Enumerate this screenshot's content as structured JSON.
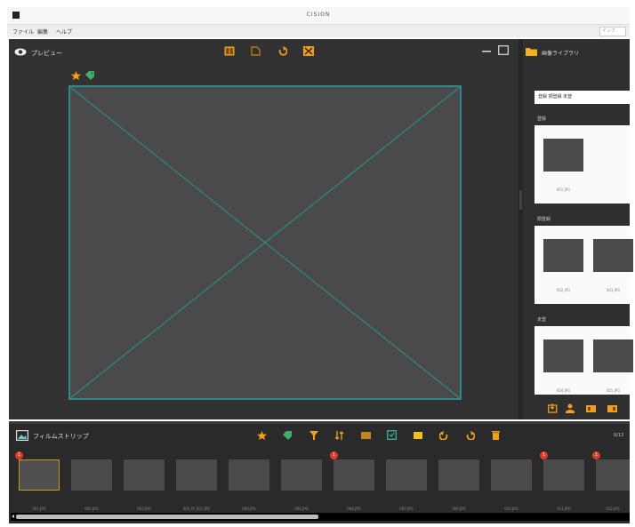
{
  "window": {
    "title": "CISION"
  },
  "menu": {
    "items": [
      "ファイル",
      "編集",
      "ヘルプ"
    ],
    "search_hint": "インフ"
  },
  "preview": {
    "label": "プレビュー",
    "colors": {
      "accent": "#f0a01a",
      "canvas_border": "#2e8a89",
      "panel": "#323232"
    }
  },
  "library": {
    "label": "画像ライブラリ",
    "select_value": "登録 顔登録 未登",
    "sections": [
      {
        "label": "登録",
        "items": [
          "001.JPG"
        ]
      },
      {
        "label": "顔登録",
        "items": [
          "002.JPG",
          "003.JPG"
        ]
      },
      {
        "label": "未登",
        "items": [
          "004.JPG",
          "005.JPG"
        ]
      }
    ]
  },
  "filmstrip": {
    "label": "フィルムストリップ",
    "right_text": "0/13",
    "items": [
      {
        "caption": "001.JPG",
        "badge": "1"
      },
      {
        "caption": "002.JPG",
        "badge": ""
      },
      {
        "caption": "003.JPG",
        "badge": ""
      },
      {
        "caption": "005_IP_001.JPG",
        "badge": ""
      },
      {
        "caption": "004.JPG",
        "badge": ""
      },
      {
        "caption": "006.JPG",
        "badge": ""
      },
      {
        "caption": "008.JPG",
        "badge": "1"
      },
      {
        "caption": "007.JPG",
        "badge": ""
      },
      {
        "caption": "009.JPG",
        "badge": ""
      },
      {
        "caption": "010.JPG",
        "badge": ""
      },
      {
        "caption": "011.JPG",
        "badge": "1"
      },
      {
        "caption": "012.JPG",
        "badge": "1"
      }
    ],
    "badge_color": "#e23a28"
  }
}
